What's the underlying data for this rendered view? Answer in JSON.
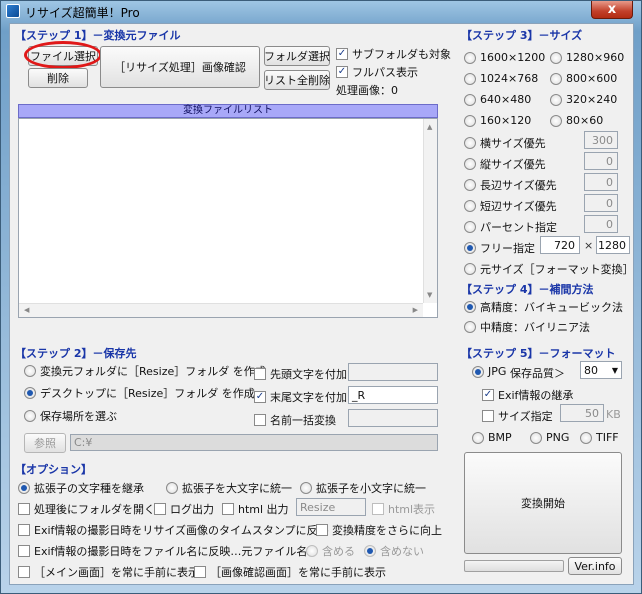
{
  "window": {
    "title": "リサイズ超簡単！Pro",
    "close_label": "x"
  },
  "step1": {
    "heading": "【ステップ 1】－変換元ファイル",
    "file_select": "ファイル選択",
    "delete": "削除",
    "resize_confirm": "［リサイズ処理］画像確認",
    "folder_select": "フォルダ選択",
    "list_clear": "リスト全削除",
    "subfolder": "サブフォルダも対象",
    "fullpath": "フルパス表示",
    "processed": "処理画像：0",
    "list_header": "変換ファイルリスト"
  },
  "step2": {
    "heading": "【ステップ 2】－保存先",
    "opt_source": "変換元フォルダに［Resize］フォルダ を作成",
    "opt_desktop": "デスクトップに［Resize］フォルダ を作成",
    "opt_choose": "保存場所を選ぶ",
    "prefix": "先頭文字を付加",
    "suffix": "末尾文字を付加",
    "suffix_value": "_R",
    "rename": "名前一括変換",
    "browse": "参照",
    "path": "C:¥"
  },
  "options": {
    "heading": "【オプション】",
    "ext_keep": "拡張子の文字種を継承",
    "ext_upper": "拡張子を大文字に統一",
    "ext_lower": "拡張子を小文字に統一",
    "open_folder": "処理後にフォルダを開く",
    "log": "ログ出力",
    "html_out": "html 出力",
    "html_value": "Resize",
    "html_show": "html表示",
    "exif_ts": "Exif情報の撮影日時をリサイズ画像のタイムスタンプに反映",
    "precision": "変換精度をさらに向上",
    "exif_name": "Exif情報の撮影日時をファイル名に反映…元ファイル名：",
    "include": "含める",
    "exclude": "含めない",
    "main_front": "［メイン画面］を常に手前に表示",
    "confirm_front": "［画像確認画面］を常に手前に表示"
  },
  "step3": {
    "heading": "【ステップ 3】－サイズ",
    "s1600": "1600×1200",
    "s1280": "1280×960",
    "s1024": "1024×768",
    "s800": "800×600",
    "s640": "640×480",
    "s320": "320×240",
    "s160": "160×120",
    "s80": "80×60",
    "width_priority": "横サイズ優先",
    "width_value": "300",
    "height_priority": "縦サイズ優先",
    "height_value": "0",
    "long_priority": "長辺サイズ優先",
    "long_value": "0",
    "short_priority": "短辺サイズ優先",
    "short_value": "0",
    "percent": "パーセント指定",
    "percent_value": "0",
    "free": "フリー指定",
    "free_w": "720",
    "times": "×",
    "free_h": "1280",
    "original": "元サイズ［フォーマット変換］"
  },
  "step4": {
    "heading": "【ステップ 4】－補間方法",
    "high": "高精度：バイキュービック法",
    "mid": "中精度：バイリニア法"
  },
  "step5": {
    "heading": "【ステップ 5】－フォーマット",
    "jpg": "JPG",
    "quality_label": "保存品質＞",
    "quality_value": "80",
    "exif_keep": "Exif情報の継承",
    "size_spec": "サイズ指定",
    "size_value": "50",
    "size_unit": "KB",
    "bmp": "BMP",
    "png": "PNG",
    "tiff": "TIFF"
  },
  "actions": {
    "convert": "変換開始",
    "verinfo": "Ver.info"
  }
}
